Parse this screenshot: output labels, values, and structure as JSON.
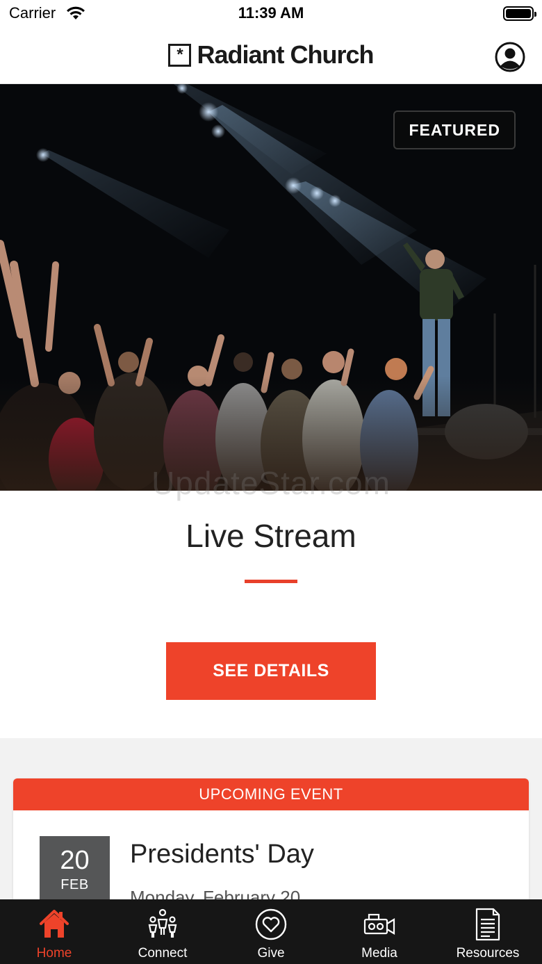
{
  "status_bar": {
    "carrier": "Carrier",
    "time": "11:39 AM"
  },
  "header": {
    "logo_glyph": "*",
    "title": "Radiant Church",
    "profile_icon": "person-circle-icon"
  },
  "hero": {
    "badge": "FEATURED"
  },
  "watermark": "UpdateStar.com",
  "featured": {
    "title": "Live Stream",
    "button_label": "SEE DETAILS",
    "accent_color": "#ee432a"
  },
  "event": {
    "header": "UPCOMING EVENT",
    "day": "20",
    "month": "FEB",
    "title": "Presidents' Day",
    "subtitle": "Monday, February 20"
  },
  "tabs": [
    {
      "label": "Home",
      "icon": "home-icon",
      "active": true
    },
    {
      "label": "Connect",
      "icon": "people-icon",
      "active": false
    },
    {
      "label": "Give",
      "icon": "heart-circle-icon",
      "active": false
    },
    {
      "label": "Media",
      "icon": "video-camera-icon",
      "active": false
    },
    {
      "label": "Resources",
      "icon": "document-icon",
      "active": false
    }
  ]
}
